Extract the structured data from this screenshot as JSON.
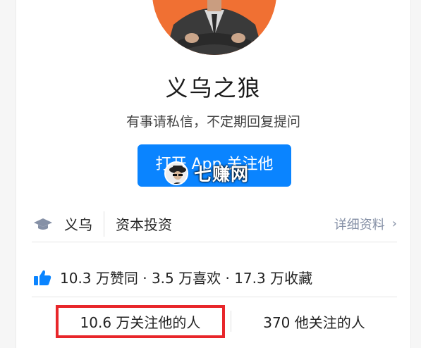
{
  "profile": {
    "name": "义乌之狼",
    "bio": "有事请私信，不定期回复提问",
    "open_app_button": "打开 App 关注他"
  },
  "watermark": {
    "text": "七赚网"
  },
  "info": {
    "location": "义乌",
    "industry": "资本投资",
    "detail_link": "详细资料",
    "detail_chevron": "›"
  },
  "stats": {
    "text": "10.3 万赞同 · 3.5 万喜欢 · 17.3 万收藏"
  },
  "follow": {
    "followers": "10.6 万关注他的人",
    "following": "370 他关注的人"
  },
  "colors": {
    "accent": "#0a84ff",
    "avatar_bg": "#f07033",
    "highlight_border": "#e8262a",
    "muted_link": "#8590a6"
  },
  "icons": [
    "graduation-cap-icon",
    "thumbs-up-icon",
    "chevron-right-icon"
  ]
}
